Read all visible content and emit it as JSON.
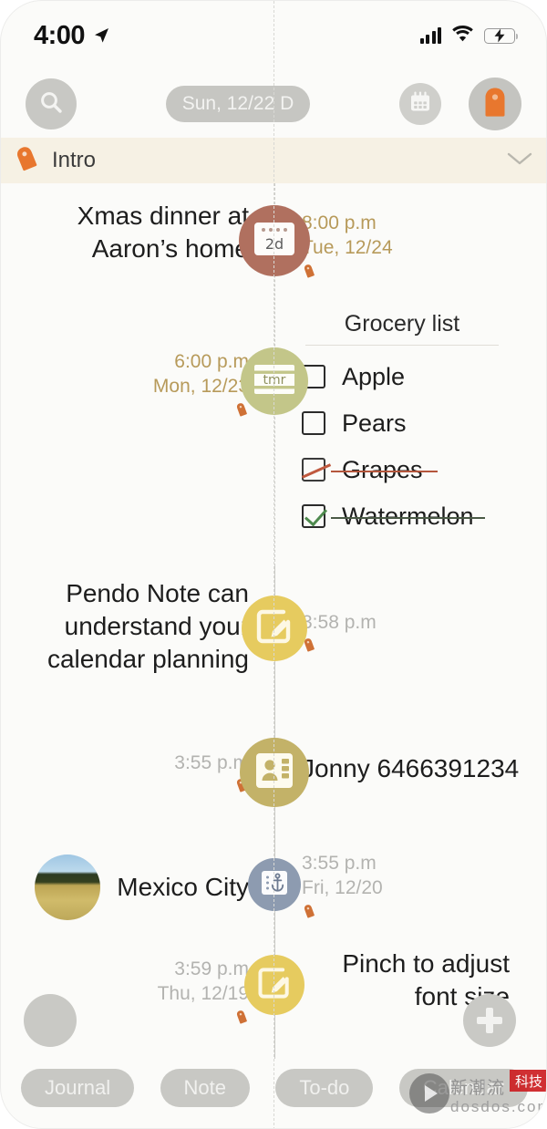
{
  "status_bar": {
    "time": "4:00",
    "location_icon": "location-arrow-icon",
    "signal_icon": "cellular-signal-icon",
    "wifi_icon": "wifi-icon",
    "battery_icon": "battery-charging-icon",
    "battery_color": "#6fc46f"
  },
  "toolbar": {
    "search_icon": "search-icon",
    "date_pill": "Sun, 12/22 D",
    "calendar_icon": "calendar-icon",
    "tag_icon": "tag-icon",
    "tag_color": "#e8772e"
  },
  "intro_banner": {
    "tag_icon": "tag-icon",
    "label": "Intro",
    "chevron_icon": "chevron-down-icon",
    "background": "#f6f1e4"
  },
  "timeline": {
    "entries": [
      {
        "side": "left",
        "title": "Xmas dinner at\nAaron’s home",
        "node_icon": "calendar-countdown-icon",
        "node_badge": "2d",
        "node_color": "#b0705f",
        "time": "8:00 p.m",
        "date": "Tue, 12/24",
        "time_color": "#b79a5a",
        "tag_marker": "tag-marker-icon"
      },
      {
        "side": "right",
        "title": "Grocery list",
        "node_icon": "todo-card-icon",
        "node_badge": "tmr",
        "node_color": "#c3c689",
        "time": "6:00 p.m",
        "date": "Mon, 12/23",
        "time_color": "#b79a5a",
        "tag_marker": "tag-marker-icon",
        "checklist": [
          {
            "label": "Apple",
            "state": "unchecked"
          },
          {
            "label": "Pears",
            "state": "unchecked"
          },
          {
            "label": "Grapes",
            "state": "cancelled"
          },
          {
            "label": "Watermelon",
            "state": "checked"
          }
        ]
      },
      {
        "side": "left",
        "title": "Pendo Note can\nunderstand your\ncalendar planning",
        "node_icon": "note-edit-icon",
        "node_color": "#e6cb5f",
        "time": "3:58 p.m",
        "date": "",
        "time_color": "#b3b3b0",
        "tag_marker": "tag-marker-icon"
      },
      {
        "side": "right",
        "title": "Jonny 6466391234",
        "node_icon": "contact-card-icon",
        "node_color": "#c3b268",
        "time": "3:55 p.m",
        "date": "",
        "time_color": "#b3b3b0",
        "tag_marker": "tag-marker-icon"
      },
      {
        "side": "left",
        "title": "Mexico City",
        "has_photo": true,
        "photo_alt": "landscape-thumbnail",
        "node_icon": "anchor-location-icon",
        "node_color": "#8d9bb0",
        "time": "3:55 p.m",
        "date": "Fri, 12/20",
        "time_color": "#b3b3b0",
        "tag_marker": "tag-marker-icon"
      },
      {
        "side": "right",
        "title": "Pinch to adjust\nfont size",
        "node_icon": "note-edit-icon",
        "node_color": "#e6cb5f",
        "time": "3:59 p.m",
        "date": "Thu, 12/19",
        "time_color": "#b3b3b0",
        "tag_marker": "tag-marker-icon"
      }
    ]
  },
  "fabs": {
    "menu_icon": "hamburger-menu-icon",
    "add_icon": "plus-icon"
  },
  "tabs": [
    {
      "label": "Journal"
    },
    {
      "label": "Note"
    },
    {
      "label": "To-do"
    },
    {
      "label": "Calendar"
    }
  ],
  "watermark": {
    "play_icon": "play-button-icon",
    "cn_text": "新潮流",
    "badge_text": "科技",
    "url": "dosdos.com"
  }
}
